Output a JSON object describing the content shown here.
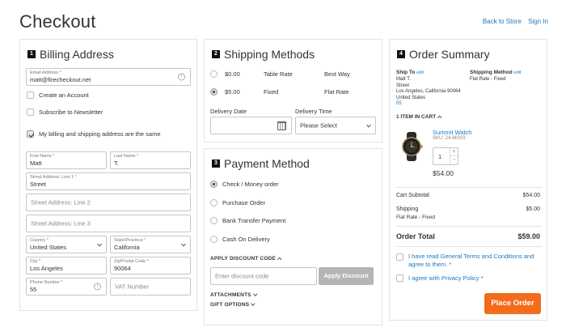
{
  "page": {
    "title": "Checkout"
  },
  "top_links": {
    "back_to_store": "Back to Store",
    "sign_in": "Sign In"
  },
  "billing": {
    "step": "1",
    "title": "Billing Address",
    "email": {
      "label": "Email Address *",
      "value": "matt@firecheckout.net"
    },
    "create_account": "Create an Account",
    "subscribe": "Subscribe to Newsletter",
    "same_address": "My billing and shipping address are the same",
    "first_name": {
      "label": "First Name *",
      "value": "Matt"
    },
    "last_name": {
      "label": "Last Name *",
      "value": "T."
    },
    "street1": {
      "label": "Street Address: Line 1 *",
      "value": "Street"
    },
    "street2_placeholder": "Street Address: Line 2",
    "street3_placeholder": "Street Address: Line 3",
    "country": {
      "label": "Country *",
      "value": "United States"
    },
    "state": {
      "label": "State/Province *",
      "value": "California"
    },
    "city": {
      "label": "City *",
      "value": "Los Angeles"
    },
    "zip": {
      "label": "Zip/Postal Code *",
      "value": "90064"
    },
    "phone": {
      "label": "Phone Number *",
      "value": "55"
    },
    "vat_placeholder": "VAT Number"
  },
  "shipping": {
    "step": "2",
    "title": "Shipping Methods",
    "methods": [
      {
        "price": "$0.00",
        "rate": "Table Rate",
        "carrier": "Best Way",
        "selected": false
      },
      {
        "price": "$5.00",
        "rate": "Fixed",
        "carrier": "Flat Rate",
        "selected": true
      }
    ],
    "delivery_date_label": "Delivery Date",
    "delivery_time_label": "Delivery Time",
    "delivery_time_value": "Please Select"
  },
  "payment": {
    "step": "3",
    "title": "Payment Method",
    "methods": [
      {
        "label": "Check / Money order",
        "selected": true
      },
      {
        "label": "Purchase Order",
        "selected": false
      },
      {
        "label": "Bank Transfer Payment",
        "selected": false
      },
      {
        "label": "Cash On Delivery",
        "selected": false
      }
    ],
    "discount_label": "APPLY DISCOUNT CODE",
    "discount_placeholder": "Enter discount code",
    "discount_button": "Apply Discount",
    "attachments_label": "ATTACHMENTS",
    "gift_options_label": "GIFT OPTIONS"
  },
  "summary": {
    "step": "4",
    "title": "Order Summary",
    "ship_to_label": "Ship To",
    "edit": "edit",
    "ship_to_lines": [
      "Matt T.",
      "Street",
      "Los Angeles, California 90064",
      "United States",
      "55"
    ],
    "shipping_method_label": "Shipping Method",
    "shipping_method_value": "Flat Rate - Fixed",
    "items_in_cart": "1 ITEM IN CART",
    "item": {
      "name": "Summit Watch",
      "sku": "SKU: 24-MG03",
      "qty": "1",
      "price": "$54.00"
    },
    "cart_subtotal_label": "Cart Subtotal",
    "cart_subtotal_value": "$54.00",
    "shipping_label": "Shipping",
    "shipping_sub": "Flat Rate - Fixed",
    "shipping_value": "$5.00",
    "order_total_label": "Order Total",
    "order_total_value": "$59.00",
    "terms_text": "I have read General Terms and Conditions and agree to them.",
    "privacy_text": "I agree with Privacy Policy",
    "place_order": "Place Order"
  },
  "colors": {
    "accent_link": "#1979c3",
    "place_order": "#f26c1b",
    "required": "#e02b27"
  }
}
